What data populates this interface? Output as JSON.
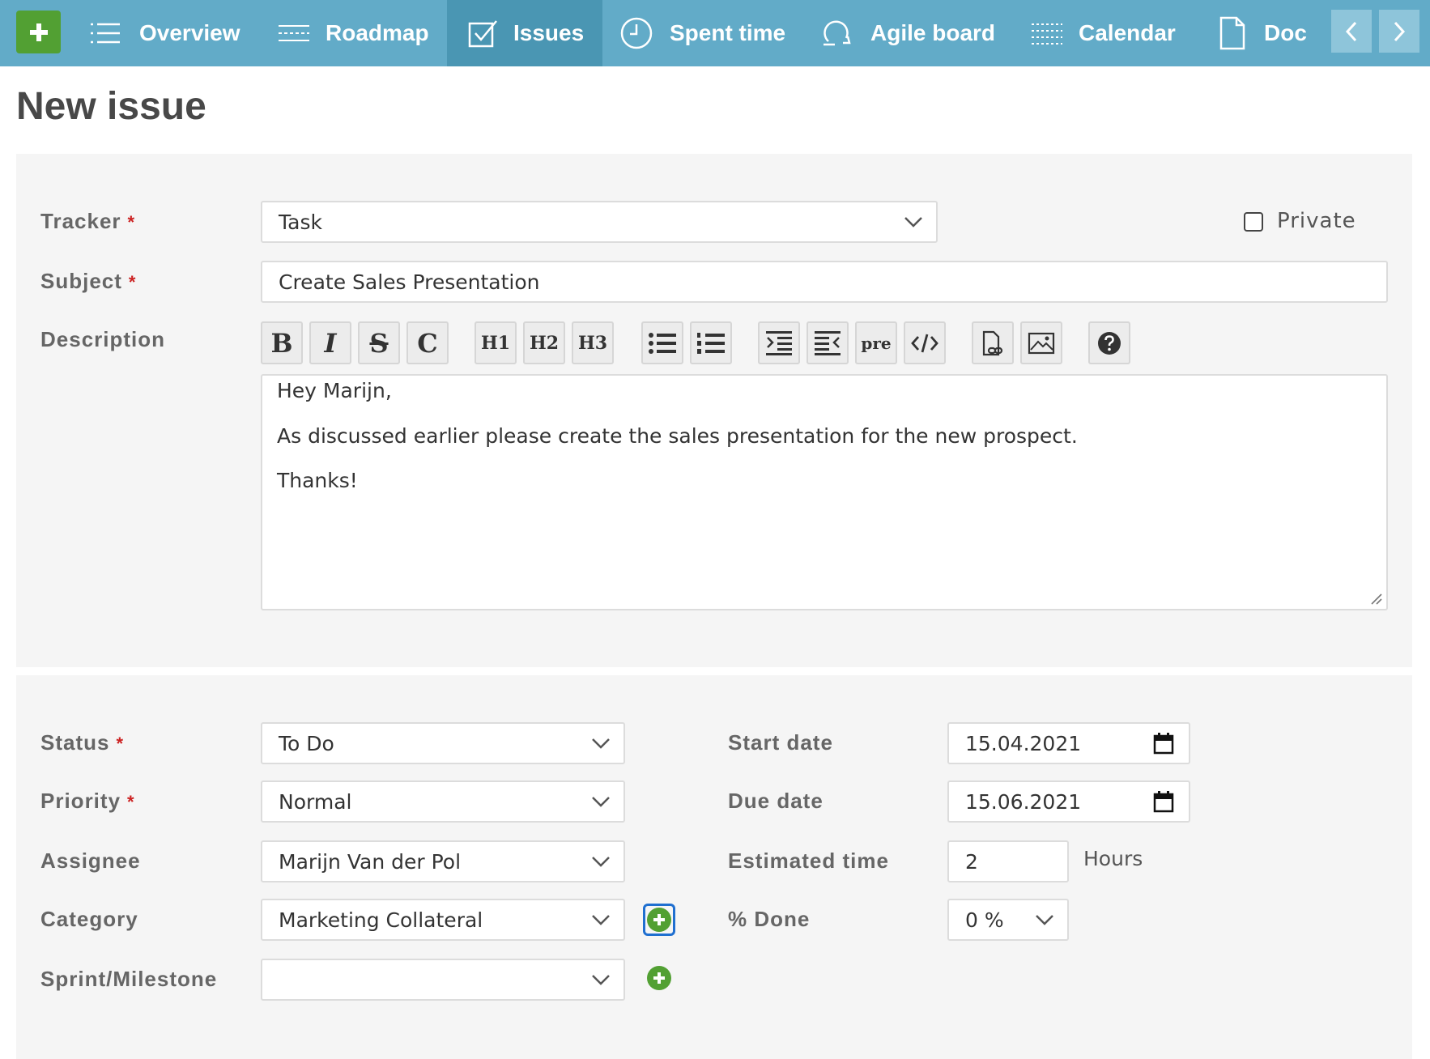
{
  "nav": {
    "items": [
      {
        "label": "Overview",
        "icon": "list-icon"
      },
      {
        "label": "Roadmap",
        "icon": "roadmap-icon"
      },
      {
        "label": "Issues",
        "icon": "checkbox-icon",
        "active": true
      },
      {
        "label": "Spent time",
        "icon": "clock-icon"
      },
      {
        "label": "Agile board",
        "icon": "agile-icon"
      },
      {
        "label": "Calendar",
        "icon": "calendar-grid-icon"
      },
      {
        "label": "Docı",
        "icon": "document-icon"
      }
    ],
    "bar_color": "#62abc8",
    "active_color": "#4a96b3",
    "plus_color": "#52a033"
  },
  "page": {
    "title": "New issue"
  },
  "form": {
    "tracker": {
      "label": "Tracker",
      "required_mark": "*",
      "value": "Task"
    },
    "private": {
      "label": "Private",
      "checked": false
    },
    "subject": {
      "label": "Subject",
      "required_mark": "*",
      "value": "Create Sales Presentation"
    },
    "description": {
      "label": "Description",
      "toolbar": [
        "B",
        "I",
        "S",
        "C",
        "H1",
        "H2",
        "H3",
        "pre"
      ],
      "lines": [
        "Hey Marijn,",
        "As discussed earlier please create the sales presentation for the new prospect.",
        "Thanks!"
      ]
    },
    "status": {
      "label": "Status",
      "required_mark": "*",
      "value": "To Do"
    },
    "priority": {
      "label": "Priority",
      "required_mark": "*",
      "value": "Normal"
    },
    "assignee": {
      "label": "Assignee",
      "value": "Marijn Van der Pol"
    },
    "category": {
      "label": "Category",
      "value": "Marketing Collateral"
    },
    "sprint": {
      "label": "Sprint/Milestone",
      "value": ""
    },
    "start_date": {
      "label": "Start date",
      "value": "15.04.2021"
    },
    "due_date": {
      "label": "Due date",
      "value": "15.06.2021"
    },
    "estimated_time": {
      "label": "Estimated time",
      "value": "2",
      "unit": "Hours"
    },
    "done": {
      "label": "% Done",
      "value": "0 %"
    }
  },
  "colors": {
    "required": "#cc2222",
    "focus": "#1f6fd0"
  }
}
